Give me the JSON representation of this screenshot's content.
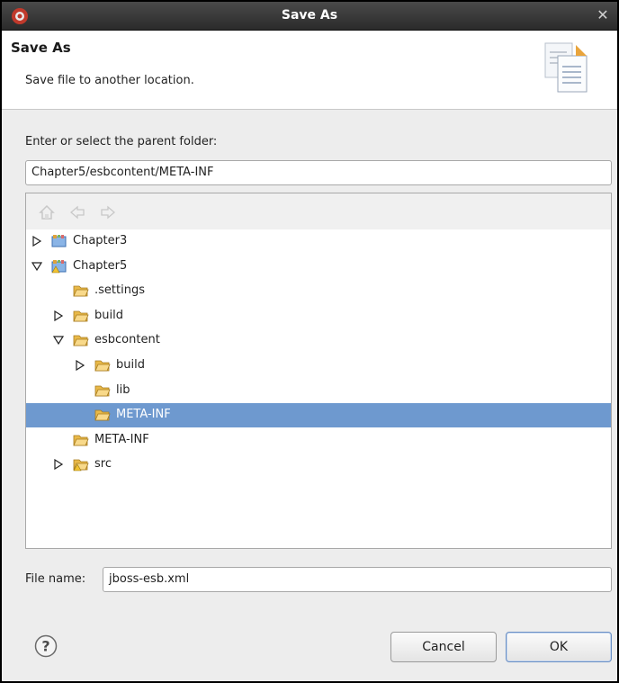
{
  "window": {
    "title": "Save As"
  },
  "header": {
    "title": "Save As",
    "subtitle": "Save file to another location."
  },
  "parent_folder": {
    "label": "Enter or select the parent folder:",
    "value": "Chapter5/esbcontent/META-INF"
  },
  "tree": {
    "toolbar": [
      "home-icon",
      "back-arrow-icon",
      "forward-arrow-icon"
    ],
    "rows": [
      {
        "label": "Chapter3",
        "level": 0,
        "twisty": "collapsed",
        "icon": "project-icon",
        "selected": false
      },
      {
        "label": "Chapter5",
        "level": 0,
        "twisty": "expanded",
        "icon": "project-warning-icon",
        "selected": false
      },
      {
        "label": ".settings",
        "level": 1,
        "twisty": "none",
        "icon": "folder-icon",
        "selected": false
      },
      {
        "label": "build",
        "level": 1,
        "twisty": "collapsed",
        "icon": "folder-icon",
        "selected": false
      },
      {
        "label": "esbcontent",
        "level": 1,
        "twisty": "expanded",
        "icon": "folder-icon",
        "selected": false
      },
      {
        "label": "build",
        "level": 2,
        "twisty": "collapsed",
        "icon": "folder-icon",
        "selected": false
      },
      {
        "label": "lib",
        "level": 2,
        "twisty": "none",
        "icon": "folder-icon",
        "selected": false
      },
      {
        "label": "META-INF",
        "level": 2,
        "twisty": "none",
        "icon": "folder-icon",
        "selected": true
      },
      {
        "label": "META-INF",
        "level": 1,
        "twisty": "none",
        "icon": "folder-icon",
        "selected": false
      },
      {
        "label": "src",
        "level": 1,
        "twisty": "collapsed",
        "icon": "source-folder-warning-icon",
        "selected": false
      }
    ]
  },
  "file_name": {
    "label": "File name:",
    "value": "jboss-esb.xml"
  },
  "buttons": {
    "cancel": "Cancel",
    "ok": "OK"
  },
  "colors": {
    "selection": "#6e99cf",
    "titlebar": "#2b2b2b",
    "folder": "#e9b949"
  }
}
